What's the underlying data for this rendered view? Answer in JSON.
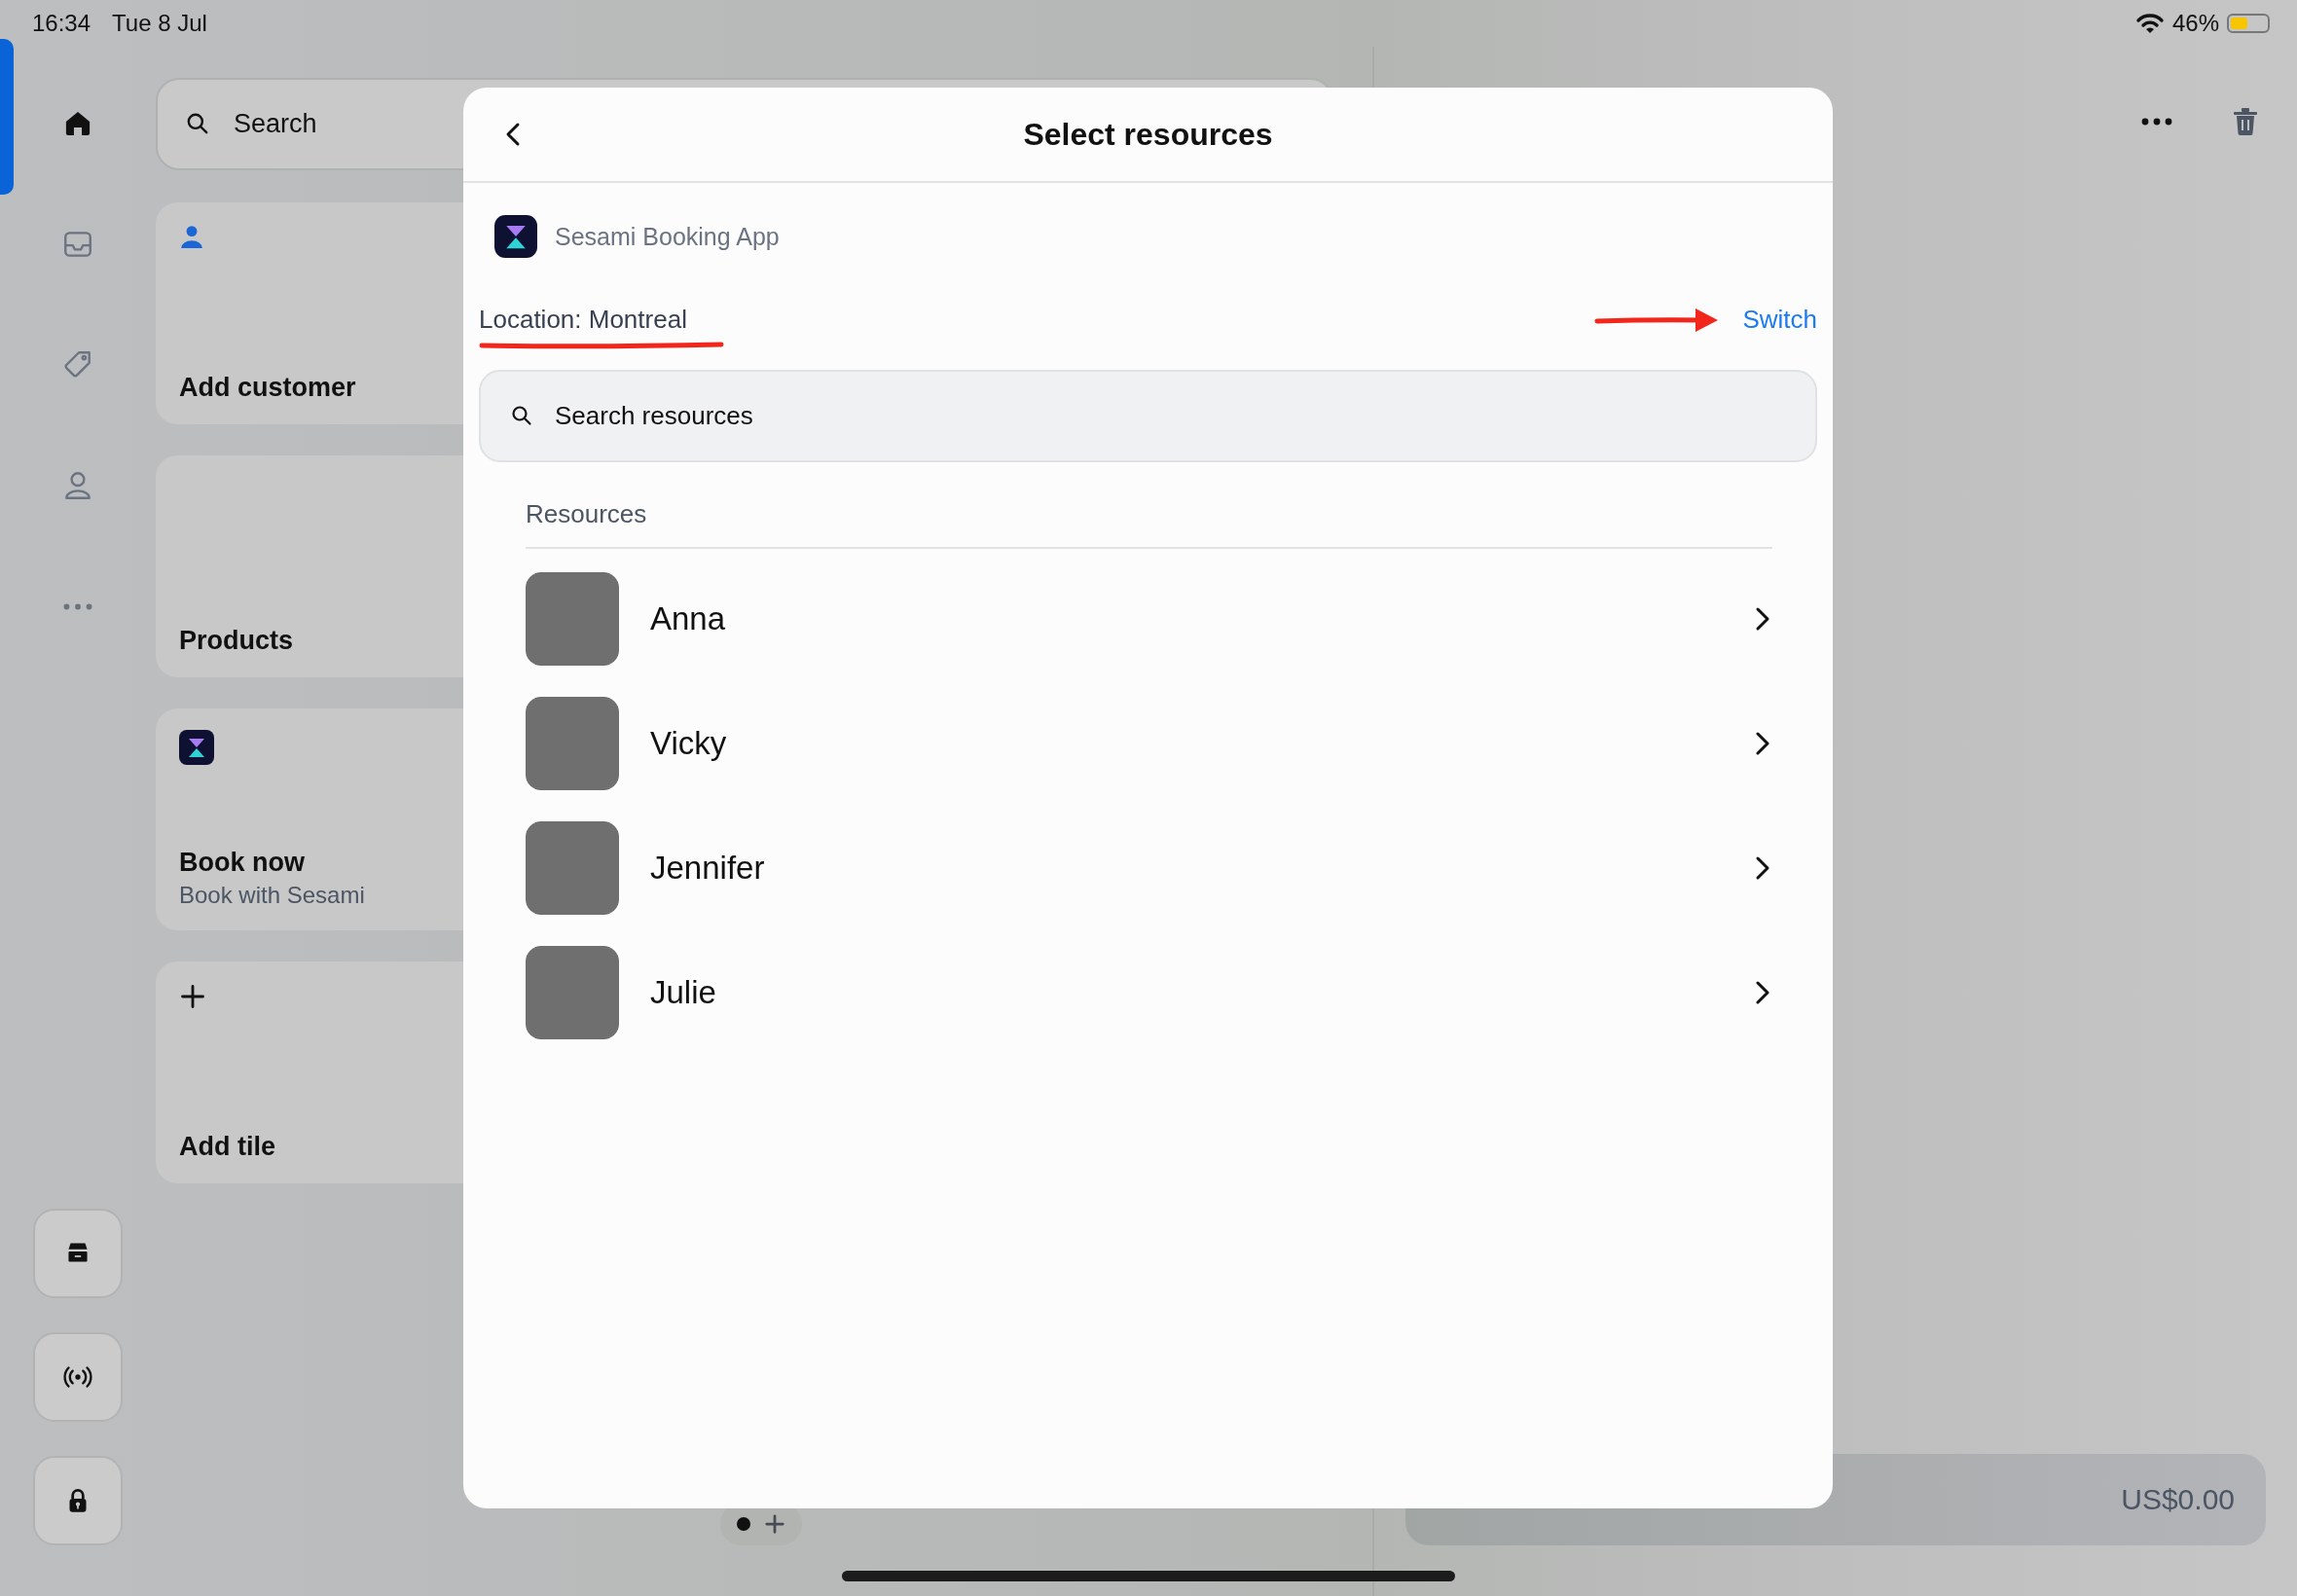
{
  "status_bar": {
    "time": "16:34",
    "date": "Tue 8 Jul",
    "battery": "46%"
  },
  "nav": [
    {
      "selected": true
    },
    {
      "selected": false
    },
    {
      "selected": false
    },
    {
      "selected": false
    },
    {
      "selected": false
    }
  ],
  "search": {
    "placeholder": "Search"
  },
  "tiles": [
    {
      "kind": "customer",
      "title": "Add customer"
    },
    {
      "kind": "products",
      "title": "Products"
    },
    {
      "kind": "app",
      "title": "Book now",
      "subtitle": "Book with Sesami"
    },
    {
      "kind": "add",
      "title": "Add tile"
    }
  ],
  "cart": {
    "total": "US$0.00"
  },
  "modal": {
    "title": "Select resources",
    "app_name": "Sesami Booking App",
    "location": "Location: Montreal",
    "switch_label": "Switch",
    "search": {
      "placeholder": "Search resources"
    },
    "section": "Resources",
    "resources": [
      {
        "name": "Anna"
      },
      {
        "name": "Vicky"
      },
      {
        "name": "Jennifer"
      },
      {
        "name": "Julie"
      }
    ]
  }
}
